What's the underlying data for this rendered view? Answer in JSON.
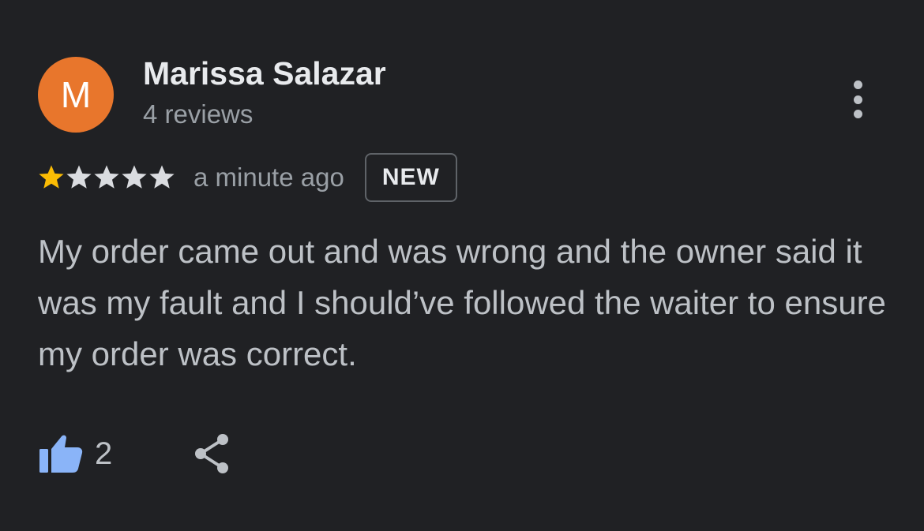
{
  "review": {
    "author": {
      "initial": "M",
      "name": "Marissa Salazar",
      "review_count": "4 reviews",
      "avatar_color": "#e8762c"
    },
    "rating": 1,
    "max_rating": 5,
    "timestamp": "a minute ago",
    "badge": "NEW",
    "text": "My order came out and was wrong and the owner said it was my fault and I should’ve followed the waiter to ensure my order was correct.",
    "likes": "2"
  },
  "icons": {
    "more": "more-vert-icon",
    "star": "star-icon",
    "like": "thumbs-up-icon",
    "share": "share-icon"
  },
  "colors": {
    "background": "#202124",
    "star_filled": "#fbbc04",
    "star_empty": "#dadce0",
    "like_icon": "#8ab4f8",
    "secondary_text": "#9aa0a6"
  }
}
